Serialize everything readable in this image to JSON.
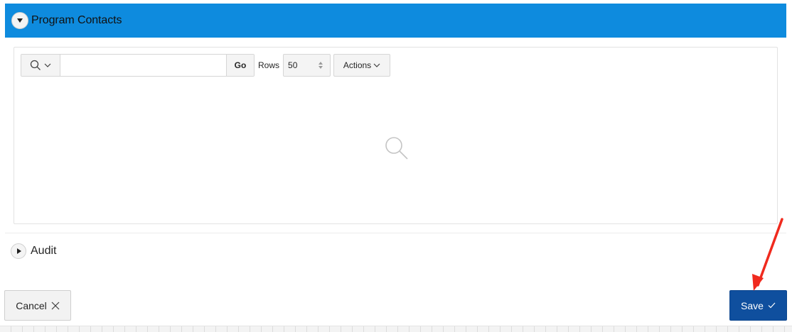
{
  "region": {
    "title": "Program Contacts",
    "header_color": "#0e8bde"
  },
  "toolbar": {
    "search_placeholder": "",
    "go_label": "Go",
    "rows_label": "Rows",
    "rows_value": "50",
    "actions_label": "Actions"
  },
  "audit": {
    "title": "Audit"
  },
  "buttons": {
    "cancel_label": "Cancel",
    "save_label": "Save",
    "save_color": "#0f4f9e"
  },
  "icons": {
    "region_toggle": "triangle-down-icon",
    "search_column": "search-icon",
    "empty_state": "search-icon",
    "audit_toggle": "triangle-right-icon",
    "cancel": "close-icon",
    "save": "check-icon"
  },
  "annotation": {
    "arrow_color": "#f02a1e"
  }
}
